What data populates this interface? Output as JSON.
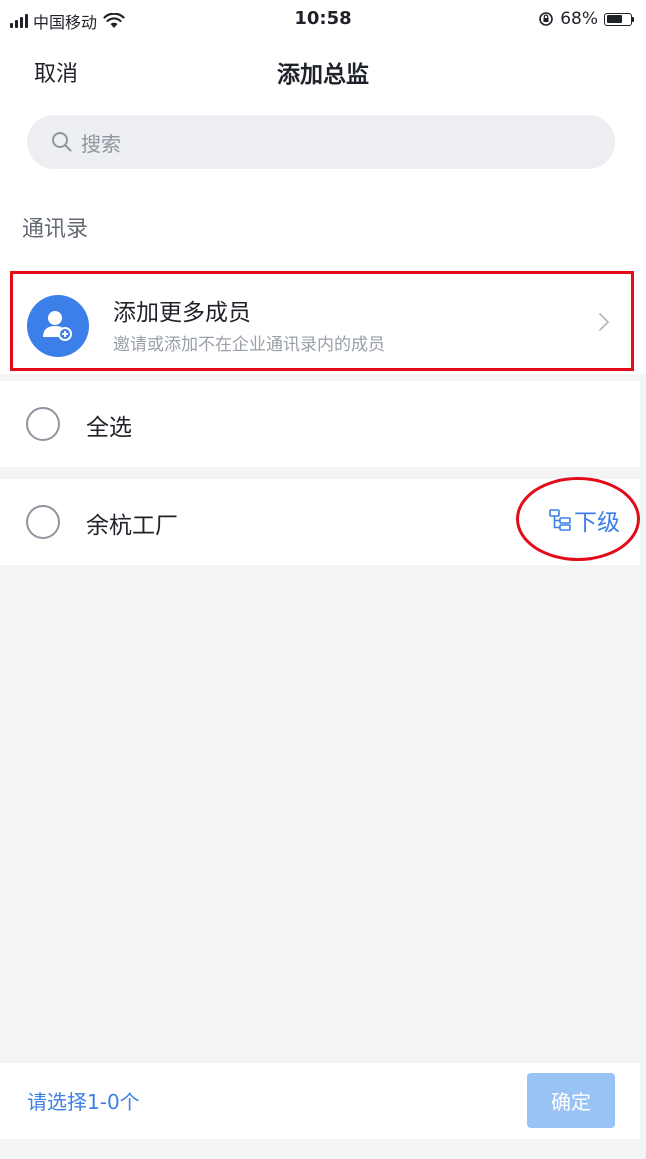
{
  "status_bar": {
    "carrier": "中国移动",
    "time": "10:58",
    "battery_text": "68%",
    "battery_level": 0.68
  },
  "nav": {
    "cancel_label": "取消",
    "title": "添加总监"
  },
  "search": {
    "placeholder": "搜索"
  },
  "contacts": {
    "section_title": "通讯录",
    "add_member": {
      "title": "添加更多成员",
      "subtitle": "邀请或添加不在企业通讯录内的成员"
    },
    "select_all_label": "全选",
    "departments": [
      {
        "name": "余杭工厂",
        "sub_level_label": "下级"
      }
    ]
  },
  "footer": {
    "selection_count": "请选择1-0个",
    "confirm_label": "确定"
  },
  "colors": {
    "accent": "#3c7fe8",
    "annotation": "#e30b17",
    "confirm_disabled": "#99c3f5"
  }
}
